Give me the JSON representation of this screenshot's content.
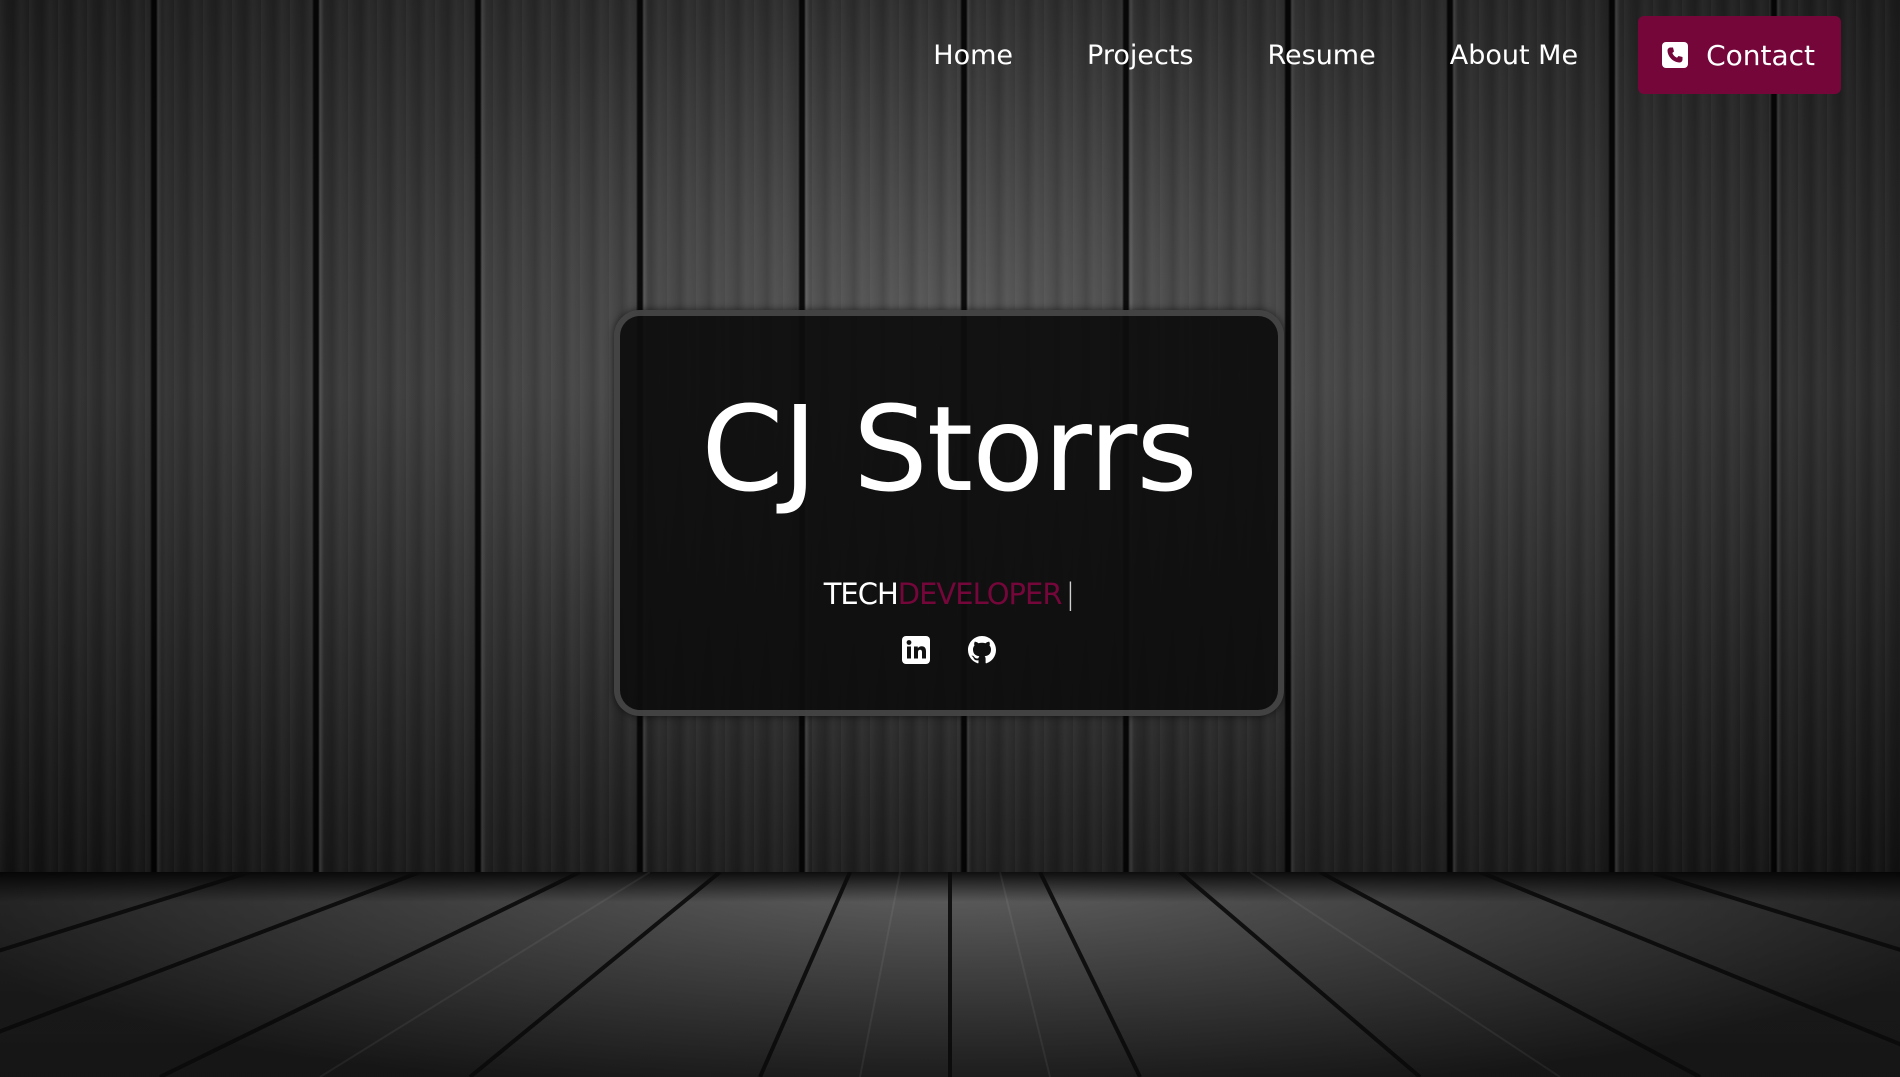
{
  "nav": {
    "links": [
      {
        "label": "Home"
      },
      {
        "label": "Projects"
      },
      {
        "label": "Resume"
      },
      {
        "label": "About Me"
      }
    ],
    "contact_label": "Contact",
    "contact_icon": "phone-square-icon",
    "accent_color": "#74063a"
  },
  "hero": {
    "name": "CJ Storrs",
    "tagline_prefix": "TECH",
    "tagline_highlight": "DEVELOPER",
    "tagline_cursor": "|",
    "socials": [
      {
        "icon": "linkedin-icon"
      },
      {
        "icon": "github-icon"
      }
    ]
  },
  "background": {
    "theme": "dark wood planks"
  }
}
